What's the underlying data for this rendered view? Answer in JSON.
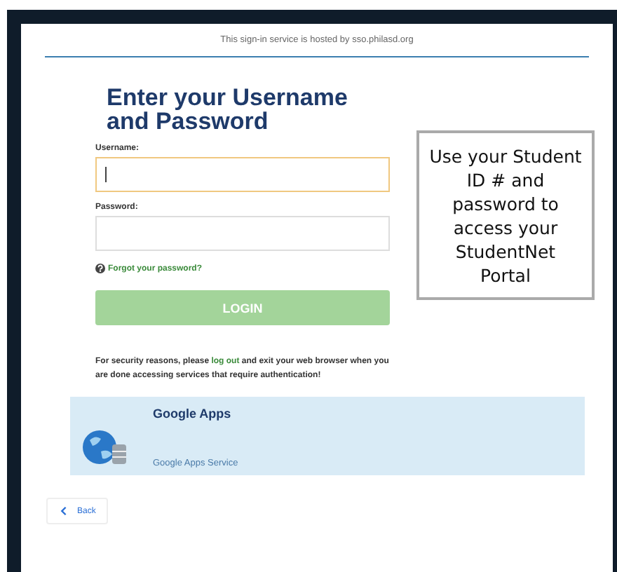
{
  "header": {
    "text": "This sign-in service is hosted by sso.philasd.org"
  },
  "title": "Enter your Username and Password",
  "fields": [
    {
      "label": "Username:",
      "focused": true
    },
    {
      "label": "Password:",
      "focused": false
    }
  ],
  "forgot_link": "Forgot your password?",
  "login_button": {
    "label": "LOGIN",
    "disabled": true
  },
  "security_note": {
    "before": "For security reasons, please ",
    "link": "log out",
    "after": " and exit your web browser when you are done accessing services that require authentication!"
  },
  "service_card": {
    "name": "Google Apps",
    "description": "Google Apps Service"
  },
  "back_button": "Back",
  "callout": "Use your Student ID # and password to access your StudentNet Portal"
}
